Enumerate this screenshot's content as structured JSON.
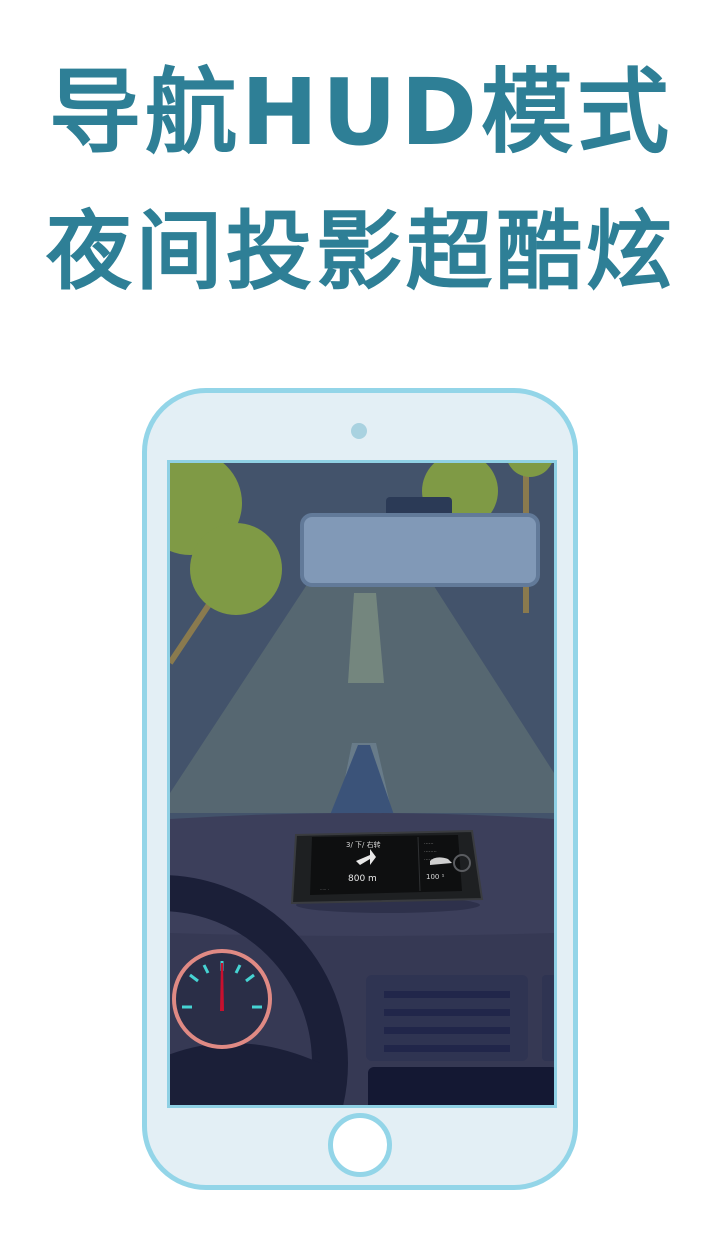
{
  "headline": {
    "line1": "导航HUD模式",
    "line2": "夜间投影超酷炫"
  },
  "illustration": {
    "hud_phone": {
      "maneuver_text": "3/ 下/ 右转",
      "distance_text": "800 m",
      "side_lines": [
        "······",
        "········",
        "·····"
      ],
      "speed_text": "100 ¹",
      "footer_text": "····· ·"
    },
    "icons": [
      "turn-arrow-icon",
      "car-icon"
    ]
  },
  "colors": {
    "headline": "#2e7f96",
    "phone_frame": "#93d5e8",
    "phone_body": "#e3eff5",
    "sky": "#40506a",
    "dashboard": "#3b3f5c",
    "tree": "#7f9a45",
    "gauge_ring": "#e08a84",
    "gauge_ticks": "#46d3d3"
  }
}
